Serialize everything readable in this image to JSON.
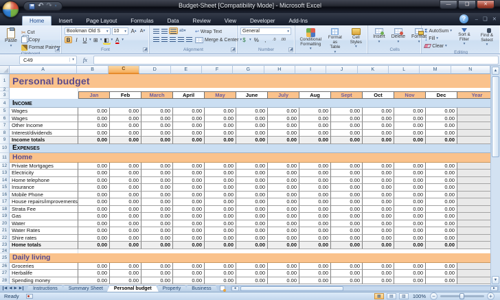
{
  "colors": {
    "accent_orange": "#FAC28C",
    "section_blue": "#CADEF2",
    "title_purple": "#5A4A8B",
    "totals_gray": "#EFEFEF",
    "selected_column_orange": "#F5AD5A"
  },
  "window": {
    "title": "Budget-Sheet  [Compatibility Mode] - Microsoft Excel",
    "tabs": [
      "Home",
      "Insert",
      "Page Layout",
      "Formulas",
      "Data",
      "Review",
      "View",
      "Developer",
      "Add-Ins"
    ],
    "active_tab": "Home"
  },
  "glyphs": {
    "undo": "↶",
    "redo": "↷",
    "qat_dropdown": "▾",
    "minimize": "—",
    "restore": "❏",
    "close": "✕",
    "help": "?",
    "wb_minimize": "–",
    "wb_restore": "❏",
    "wb_close": "✕",
    "cut": "✂",
    "bold": "B",
    "italic": "I",
    "underline": "U",
    "borders": "⊞",
    "fill_arrow": "▾",
    "orientation": "ab",
    "currency": "$",
    "percent": "%",
    "comma": ",",
    "inc_dec": ".0",
    "dec_dec": ".00",
    "autosum": "Σ",
    "fill": "↓",
    "fx": "fx",
    "scroll_up": "▲",
    "scroll_down": "▼",
    "scroll_left": "◄",
    "scroll_right": "►",
    "nav_first": "◀",
    "nav_prev": "◀",
    "nav_next": "▶",
    "nav_last": "▶",
    "zoom_out": "−",
    "zoom_in": "+",
    "view_normal": "▦",
    "view_page": "▤",
    "view_break": "▥"
  },
  "ribbon": {
    "clipboard": {
      "label": "Clipboard",
      "paste": "Paste",
      "cut": "Cut",
      "copy": "Copy",
      "format_painter": "Format Painter"
    },
    "font": {
      "label": "Font",
      "name": "Bookman Old S",
      "size": "10"
    },
    "alignment": {
      "label": "Alignment",
      "wrap_text": "Wrap Text",
      "merge_center": "Merge & Center"
    },
    "number": {
      "label": "Number",
      "format": "General"
    },
    "styles": {
      "label": "Styles",
      "conditional": "Conditional Formatting",
      "format_table": "Format as Table",
      "cell_styles": "Cell Styles"
    },
    "cells": {
      "label": "Cells",
      "insert": "Insert",
      "delete": "Delete",
      "format": "Format"
    },
    "editing": {
      "label": "Editing",
      "autosum": "AutoSum",
      "fill": "Fill",
      "clear": "Clear",
      "sort": "Sort & Filter",
      "find": "Find & Select"
    }
  },
  "formula_bar": {
    "name_box": "C49",
    "formula": ""
  },
  "grid": {
    "columns": [
      "A",
      "B",
      "C",
      "D",
      "E",
      "F",
      "G",
      "H",
      "I",
      "J",
      "K",
      "L",
      "M",
      "N"
    ],
    "selected_column": "C",
    "selected_cell": "C49",
    "months": [
      "Jan",
      "Feb",
      "March",
      "April",
      "May",
      "June",
      "July",
      "Aug",
      "Sept",
      "Oct",
      "Nov",
      "Dec",
      "Year"
    ],
    "rows": [
      {
        "num": 1,
        "type": "title",
        "label": "Personal budget"
      },
      {
        "num": 2,
        "type": "spacer2",
        "label": ""
      },
      {
        "num": 3,
        "type": "months",
        "label": ""
      },
      {
        "num": 4,
        "type": "section_blue",
        "label": "Income"
      },
      {
        "num": 5,
        "type": "data",
        "label": "Wages",
        "values": [
          "0.00",
          "0.00",
          "0.00",
          "0.00",
          "0.00",
          "0.00",
          "0.00",
          "0.00",
          "0.00",
          "0.00",
          "0.00",
          "0.00"
        ]
      },
      {
        "num": 6,
        "type": "data",
        "label": "Wages",
        "values": [
          "0.00",
          "0.00",
          "0.00",
          "0.00",
          "0.00",
          "0.00",
          "0.00",
          "0.00",
          "0.00",
          "0.00",
          "0.00",
          "0.00"
        ]
      },
      {
        "num": 7,
        "type": "data",
        "label": "Other Income",
        "values": [
          "0.00",
          "0.00",
          "0.00",
          "0.00",
          "0.00",
          "0.00",
          "0.00",
          "0.00",
          "0.00",
          "0.00",
          "0.00",
          "0.00"
        ]
      },
      {
        "num": 8,
        "type": "data",
        "label": "Interest/dividends",
        "values": [
          "0.00",
          "0.00",
          "0.00",
          "0.00",
          "0.00",
          "0.00",
          "0.00",
          "0.00",
          "0.00",
          "0.00",
          "0.00",
          "0.00"
        ]
      },
      {
        "num": 9,
        "type": "total",
        "label": "Income totals",
        "values": [
          "0.00",
          "0.00",
          "0.00",
          "0.00",
          "0.00",
          "0.00",
          "0.00",
          "0.00",
          "0.00",
          "0.00",
          "0.00",
          "0.00"
        ]
      },
      {
        "num": 10,
        "type": "section_blue",
        "label": "Expenses"
      },
      {
        "num": 11,
        "type": "section_orange",
        "label": "Home"
      },
      {
        "num": 12,
        "type": "data",
        "label": "Private Mortgages",
        "values": [
          "0.00",
          "0.00",
          "0.00",
          "0.00",
          "0.00",
          "0.00",
          "0.00",
          "0.00",
          "0.00",
          "0.00",
          "0.00",
          "0.00"
        ]
      },
      {
        "num": 13,
        "type": "data",
        "label": "Electricity",
        "values": [
          "0.00",
          "0.00",
          "0.00",
          "0.00",
          "0.00",
          "0.00",
          "0.00",
          "0.00",
          "0.00",
          "0.00",
          "0.00",
          "0.00"
        ]
      },
      {
        "num": 14,
        "type": "data",
        "label": "Home telephone",
        "values": [
          "0.00",
          "0.00",
          "0.00",
          "0.00",
          "0.00",
          "0.00",
          "0.00",
          "0.00",
          "0.00",
          "0.00",
          "0.00",
          "0.00"
        ]
      },
      {
        "num": 15,
        "type": "data",
        "label": "Insurance",
        "values": [
          "0.00",
          "0.00",
          "0.00",
          "0.00",
          "0.00",
          "0.00",
          "0.00",
          "0.00",
          "0.00",
          "0.00",
          "0.00",
          "0.00"
        ]
      },
      {
        "num": 16,
        "type": "data",
        "label": "Mobile Phone",
        "values": [
          "0.00",
          "0.00",
          "0.00",
          "0.00",
          "0.00",
          "0.00",
          "0.00",
          "0.00",
          "0.00",
          "0.00",
          "0.00",
          "0.00"
        ]
      },
      {
        "num": 17,
        "type": "data",
        "label": "House repairs/improvements",
        "values": [
          "0.00",
          "0.00",
          "0.00",
          "0.00",
          "0.00",
          "0.00",
          "0.00",
          "0.00",
          "0.00",
          "0.00",
          "0.00",
          "0.00"
        ]
      },
      {
        "num": 18,
        "type": "data",
        "label": "Strata Fee",
        "values": [
          "0.00",
          "0.00",
          "0.00",
          "0.00",
          "0.00",
          "0.00",
          "0.00",
          "0.00",
          "0.00",
          "0.00",
          "0.00",
          "0.00"
        ]
      },
      {
        "num": 19,
        "type": "data",
        "label": "Gas",
        "values": [
          "0.00",
          "0.00",
          "0.00",
          "0.00",
          "0.00",
          "0.00",
          "0.00",
          "0.00",
          "0.00",
          "0.00",
          "0.00",
          "0.00"
        ]
      },
      {
        "num": 20,
        "type": "data",
        "label": "Water",
        "values": [
          "0.00",
          "0.00",
          "0.00",
          "0.00",
          "0.00",
          "0.00",
          "0.00",
          "0.00",
          "0.00",
          "0.00",
          "0.00",
          "0.00"
        ]
      },
      {
        "num": 21,
        "type": "data",
        "label": "Water Rates",
        "values": [
          "0.00",
          "0.00",
          "0.00",
          "0.00",
          "0.00",
          "0.00",
          "0.00",
          "0.00",
          "0.00",
          "0.00",
          "0.00",
          "0.00"
        ]
      },
      {
        "num": 22,
        "type": "data",
        "label": "Shire rates",
        "values": [
          "0.00",
          "0.00",
          "0.00",
          "0.00",
          "0.00",
          "0.00",
          "0.00",
          "0.00",
          "0.00",
          "0.00",
          "0.00",
          "0.00"
        ]
      },
      {
        "num": 23,
        "type": "total",
        "label": "Home totals",
        "values": [
          "0.00",
          "0.00",
          "0.00",
          "0.00",
          "0.00",
          "0.00",
          "0.00",
          "0.00",
          "0.00",
          "0.00",
          "0.00",
          "0.00"
        ]
      },
      {
        "num": 24,
        "type": "spacer",
        "label": ""
      },
      {
        "num": 25,
        "type": "section_orange",
        "label": "Daily living"
      },
      {
        "num": 26,
        "type": "data",
        "label": "Groceries",
        "values": [
          "0.00",
          "0.00",
          "0.00",
          "0.00",
          "0.00",
          "0.00",
          "0.00",
          "0.00",
          "0.00",
          "0.00",
          "0.00",
          "0.00"
        ]
      },
      {
        "num": 27,
        "type": "data",
        "label": "Herbalife",
        "values": [
          "0.00",
          "0.00",
          "0.00",
          "0.00",
          "0.00",
          "0.00",
          "0.00",
          "0.00",
          "0.00",
          "0.00",
          "0.00",
          "0.00"
        ]
      },
      {
        "num": 28,
        "type": "data",
        "label": "Spending money",
        "values": [
          "0.00",
          "0.00",
          "0.00",
          "0.00",
          "0.00",
          "0.00",
          "0.00",
          "0.00",
          "0.00",
          "0.00",
          "0.00",
          "0.00"
        ]
      }
    ]
  },
  "sheet_tabs": {
    "tabs": [
      "Instructions",
      "Summary Sheet",
      "Personal budget",
      "Property",
      "Business"
    ],
    "active": "Personal budget"
  },
  "status_bar": {
    "mode": "Ready",
    "zoom": "100%"
  }
}
